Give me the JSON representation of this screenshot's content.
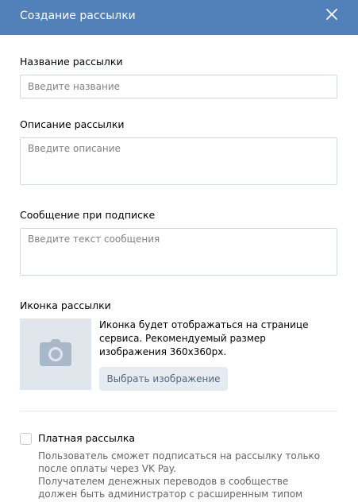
{
  "header": {
    "title": "Создание рассылки",
    "close_icon": "close-icon"
  },
  "name_field": {
    "label": "Название рассылки",
    "placeholder": "Введите название",
    "value": ""
  },
  "description_field": {
    "label": "Описание рассылки",
    "placeholder": "Введите описание",
    "value": ""
  },
  "subscribe_message_field": {
    "label": "Сообщение при подписке",
    "placeholder": "Введите текст сообщения",
    "value": ""
  },
  "icon_section": {
    "label": "Иконка рассылки",
    "placeholder_icon": "camera-icon",
    "description": "Иконка будет отображаться на странице сервиса. Рекомендуемый размер изображения 360x360px.",
    "choose_button": "Выбрать изображение"
  },
  "paid": {
    "checked": false,
    "label": "Платная рассылка",
    "description_line1": "Пользователь сможет подписаться на рассылку только после оплаты через VK Pay.",
    "description_line2": "Получателем денежных переводов в сообществе должен быть администратор с расширенным типом аккаунта VK Pay."
  },
  "colors": {
    "header_bg": "#5181b8",
    "input_border": "#d3d9de",
    "button_bg": "#e5ebf1",
    "button_text": "#55677d",
    "placeholder_bg": "#e1e6ed",
    "camera_icon": "#a9b8c8"
  }
}
